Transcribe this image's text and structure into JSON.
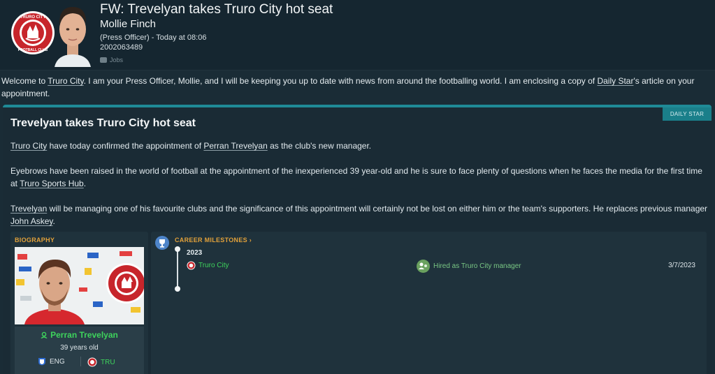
{
  "email": {
    "subject": "FW: Trevelyan takes Truro City hot seat",
    "sender_name": "Mollie Finch",
    "sender_meta": "(Press Officer) - Today at 08:06",
    "sender_id": "2002063489",
    "tag": "Jobs"
  },
  "intro": {
    "p1": "Welcome to ",
    "club": "Truro City",
    "p2": ". I am your Press Officer, Mollie, and I will be keeping you up to date with news from around the footballing world. I am enclosing a copy of ",
    "paper": "Daily Star",
    "p3": "'s article on your appointment."
  },
  "article": {
    "source": "DAILY STAR",
    "headline": "Trevelyan takes Truro City hot seat",
    "para1": {
      "club": "Truro City",
      "t1": " have today confirmed the appointment of ",
      "manager": "Perran Trevelyan",
      "t2": " as the club's new manager."
    },
    "para2": {
      "t1": "Eyebrows have been raised in the world of football at the appointment of the inexperienced 39 year-old and he is sure to face plenty of questions when he faces the media for the first time at ",
      "stadium": "Truro Sports Hub",
      "t2": "."
    },
    "para3": {
      "manager": "Trevelyan",
      "t1": " will be managing one of his favourite clubs and the significance of this appointment will certainly not be lost on either him or the team's supporters. He replaces previous manager ",
      "previous": "John Askey",
      "t2": "."
    }
  },
  "biography": {
    "title": "BIOGRAPHY",
    "name": "Perran Trevelyan",
    "age": "39 years old",
    "nationality": "ENG",
    "club": "TRU"
  },
  "career": {
    "title": "CAREER MILESTONES",
    "year": "2023",
    "club": "Truro City",
    "event": "Hired as Truro City manager",
    "date": "3/7/2023"
  },
  "badge": {
    "top_text": "TRURO CITY",
    "bottom_text": "FOOTBALL CLUB"
  },
  "colors": {
    "accent_teal": "#1f8a96",
    "milestone_orange": "#e2a13a",
    "club_green": "#3ed35c",
    "badge_red": "#c7252b"
  }
}
